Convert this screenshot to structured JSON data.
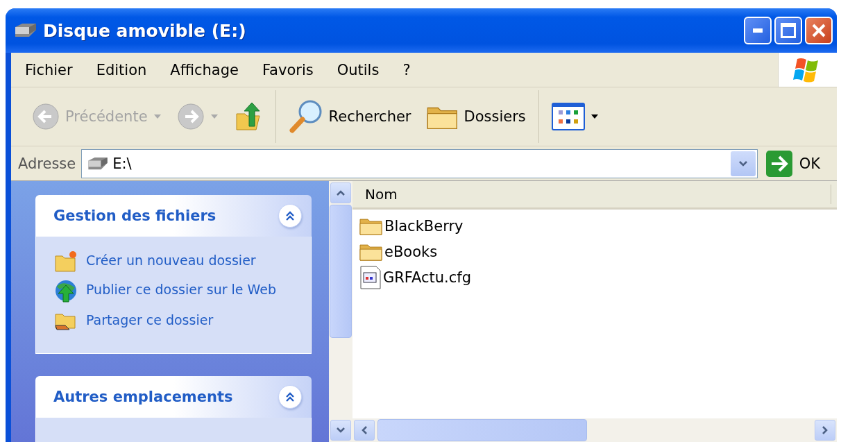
{
  "window": {
    "title": "Disque amovible (E:)"
  },
  "menu": [
    "Fichier",
    "Edition",
    "Affichage",
    "Favoris",
    "Outils",
    "?"
  ],
  "toolbar": [
    {
      "kind": "back",
      "label": "Précédente",
      "disabled": true
    },
    {
      "kind": "forward",
      "disabled": true
    },
    {
      "kind": "up",
      "disabled": false
    },
    {
      "kind": "search",
      "label": "Rechercher",
      "disabled": false
    },
    {
      "kind": "folders",
      "label": "Dossiers",
      "disabled": false
    },
    {
      "kind": "views",
      "disabled": false
    }
  ],
  "address": {
    "label": "Adresse",
    "value": "E:\\",
    "go": "OK"
  },
  "task_panels": [
    {
      "title": "Gestion des fichiers",
      "expanded": true,
      "items": [
        {
          "kind": "new-folder",
          "label": "Créer un nouveau dossier"
        },
        {
          "kind": "publish",
          "label": "Publier ce dossier sur le Web"
        },
        {
          "kind": "share",
          "label": "Partager ce dossier"
        }
      ]
    },
    {
      "title": "Autres emplacements",
      "expanded": true
    }
  ],
  "file_list": {
    "columns": [
      "Nom"
    ],
    "rows": [
      {
        "kind": "folder",
        "name": "BlackBerry"
      },
      {
        "kind": "folder",
        "name": "eBooks"
      },
      {
        "kind": "config",
        "name": "GRFActu.cfg"
      }
    ]
  }
}
